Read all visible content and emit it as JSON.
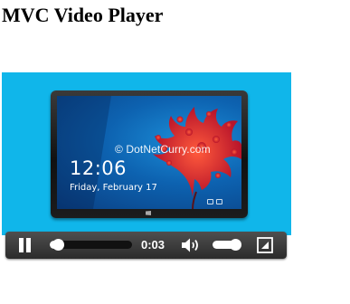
{
  "page": {
    "title": "MVC Video Player"
  },
  "video": {
    "poster": {
      "watermark": "© DotNetCurry.com",
      "lock_screen_time": "12:06",
      "lock_screen_date": "Friday, February 17"
    },
    "background_color": "#10b6ea"
  },
  "controls": {
    "state": "playing",
    "play_pause_icon": "pause-icon",
    "current_time": "0:03",
    "progress_fraction": 0.1,
    "volume_icon": "speaker-icon",
    "volume_fraction": 0.85,
    "fullscreen_icon": "fullscreen-icon",
    "bar_color": "#3a3a3a",
    "accent_color": "#ffffff"
  }
}
